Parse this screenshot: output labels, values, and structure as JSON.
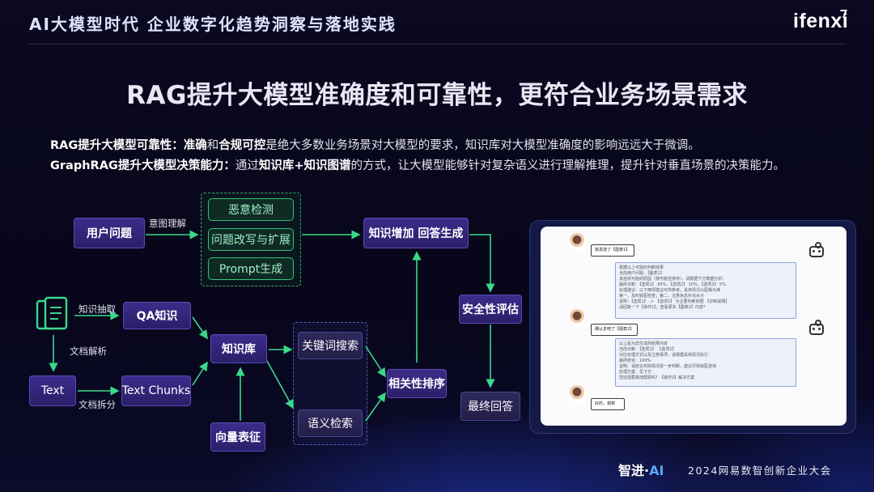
{
  "header": {
    "title": "AI大模型时代  企业数字化趋势洞察与落地实践",
    "logo": "ifenxi"
  },
  "main_title": "RAG提升大模型准确度和可靠性，更符合业务场景需求",
  "descriptions": [
    {
      "bold_lead": "RAG提升大模型可靠性：",
      "b1": "准确",
      "t1": "和",
      "b2": "合规可控",
      "t2": "是绝大多数业务场景对大模型的要求，知识库对大模型准确度的影响远远大于微调。"
    },
    {
      "bold_lead": "GraphRAG提升大模型决策能力：",
      "t0": "通过",
      "b1": "知识库+知识图谱",
      "t1": "的方式，让大模型能够针对复杂语义进行理解推理，提升针对垂直场景的决策能力。"
    }
  ],
  "diagram": {
    "nodes": {
      "user_question": "用户问题",
      "malicious_detection": "恶意检测",
      "question_rewrite": "问题改写与扩展",
      "prompt_gen": "Prompt生成",
      "knowledge_augment": "知识增加 回答生成",
      "qa_knowledge": "QA知识",
      "knowledge_base": "知识库",
      "keyword_search": "关键词搜索",
      "semantic_search": "语义检索",
      "relevance_rank": "相关性排序",
      "safety_eval": "安全性评估",
      "final_answer": "最终回答",
      "text": "Text",
      "text_chunks": "Text Chunks",
      "vector_repr": "向量表征"
    },
    "edge_labels": {
      "intent": "意图理解",
      "knowledge_extract": "知识抽取",
      "doc_parse": "文档解析",
      "doc_split": "文档拆分"
    },
    "icon": "document-icon"
  },
  "chat_panel": {
    "messages": [
      {
        "role": "user",
        "lines": [
          "我发烧了【图表1】"
        ]
      },
      {
        "role": "bot",
        "lines": [
          "根据以上可能的判断结果",
          "当前用户问题：【图表1】",
          "该症状可能的原因（按可能性排序），请根据下方数据分析：",
          "最终诊断：【选项1】 85%、【选项2】 10%、【选项3】 5%",
          "处理建议：以下两项建议可供参考，具体情况以医嘱为准",
          "第一，及时就医检查；第二，注意休息补充水分",
          "说明：【选项1】 -> 【选项2】 为主要判断依据 【诊断说明】",
          "请回复一下【操作1】，查看更多【图表2】内容？"
        ]
      },
      {
        "role": "user",
        "lines": [
          "确认去吧了【图表2】"
        ]
      },
      {
        "role": "bot",
        "lines": [
          "以上是为您生成的结果内容",
          "当前诊断：【选项1】 【选项2】",
          "对应处理方式以及注意事项，请根据具体情况执行：",
          "最终结论：100%",
          "说明：请结合实际情况进一步判断，建议尽快就医咨询",
          "处理方案：见下方",
          "您还需要其他帮助吗？【操作2】解决方案"
        ]
      },
      {
        "role": "user",
        "lines": [
          "好的，谢谢"
        ]
      }
    ]
  },
  "footer": {
    "brand_prefix": "智进·",
    "brand_ai": "AI",
    "event": "2024网易数智创新企业大会"
  },
  "colors": {
    "node_fill": "#2f2478",
    "node_border": "#5b4bb5",
    "green_accent": "#35c07a",
    "arrow": "#39d98a",
    "background": "#07061a"
  }
}
